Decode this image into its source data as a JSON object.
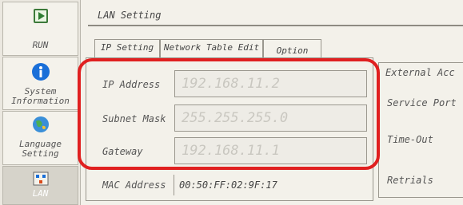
{
  "sidebar": {
    "items": [
      {
        "label": "RUN",
        "icon": "play-icon"
      },
      {
        "label": "System Information",
        "icon": "info-icon"
      },
      {
        "label": "Language Setting",
        "icon": "globe-icon"
      },
      {
        "label": "LAN",
        "icon": "network-icon",
        "active": true
      }
    ]
  },
  "header": {
    "title": "LAN Setting"
  },
  "tabs": [
    {
      "label": "IP Setting",
      "active": true
    },
    {
      "label": "Network Table Edit"
    },
    {
      "label": "Option"
    }
  ],
  "form": {
    "ip_address": {
      "label": "IP Address",
      "value": "192.168.11.2"
    },
    "subnet_mask": {
      "label": "Subnet Mask",
      "value": "255.255.255.0"
    },
    "gateway": {
      "label": "Gateway",
      "value": "192.168.11.1"
    },
    "mac_address": {
      "label": "MAC Address",
      "value": "00:50:FF:02:9F:17"
    }
  },
  "right_panel": {
    "external_access": "External Acc",
    "service_port": "Service Port",
    "time_out": "Time-Out",
    "retrials": "Retrials"
  },
  "colors": {
    "highlight": "#e02020",
    "accent_blue": "#1a6fd8"
  }
}
